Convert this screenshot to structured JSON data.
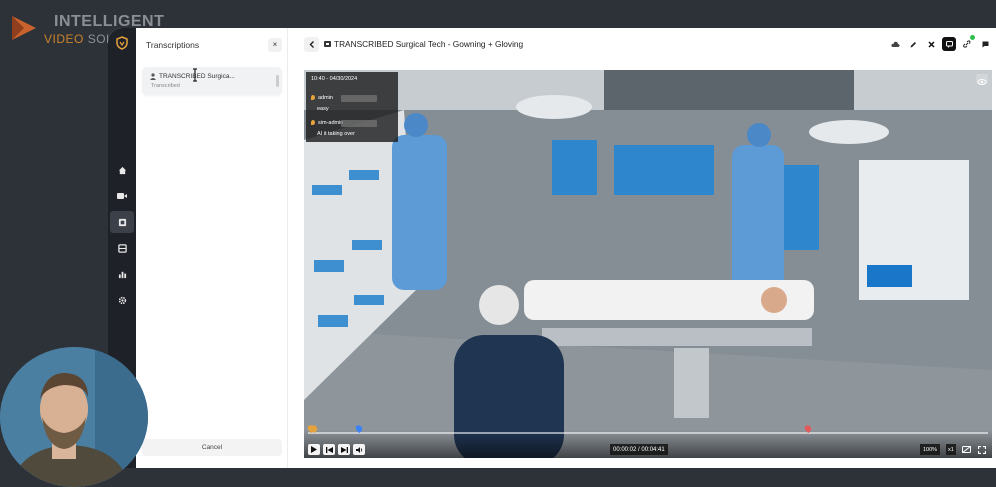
{
  "brand": {
    "line1": "INTELLIGENT",
    "line2a": "VIDEO",
    "line2b": "SOLUTIONS"
  },
  "rail": {
    "items": [
      "home-icon",
      "video-icon",
      "transcriptions-icon",
      "library-icon",
      "reports-icon",
      "settings-icon"
    ],
    "active_index": 2
  },
  "panel": {
    "title": "Transcriptions",
    "close_label": "×",
    "item": {
      "name": "TRANSCRIBED Surgica...",
      "status": "Transcribed"
    },
    "cancel_label": "Cancel"
  },
  "header": {
    "title": "TRANSCRIBED Surgical Tech - Gowning + Gloving",
    "tools": [
      "cloud-icon",
      "edit-icon",
      "close-icon",
      "chat-icon",
      "link-icon",
      "comment-icon"
    ]
  },
  "overlay": {
    "timestamp": "10:40 - 04/30/2024",
    "comments": [
      {
        "user": "admin",
        "text": "easy"
      },
      {
        "user": "sim-admin",
        "text": "AI it taking over"
      }
    ]
  },
  "player": {
    "time": "00:00:02 / 00:04:41",
    "zoom": "100%",
    "speed": "x1",
    "progress_fraction": 0.007,
    "markers": [
      {
        "pos": 0.005,
        "color": "#e6a23c"
      },
      {
        "pos": 0.009,
        "color": "#e6a23c"
      },
      {
        "pos": 0.075,
        "color": "#3b82f6"
      },
      {
        "pos": 0.735,
        "color": "#e05a5a"
      }
    ]
  },
  "colors": {
    "accent": "#c9822c",
    "rail_bg": "#1e2127",
    "background": "#2d3238"
  }
}
